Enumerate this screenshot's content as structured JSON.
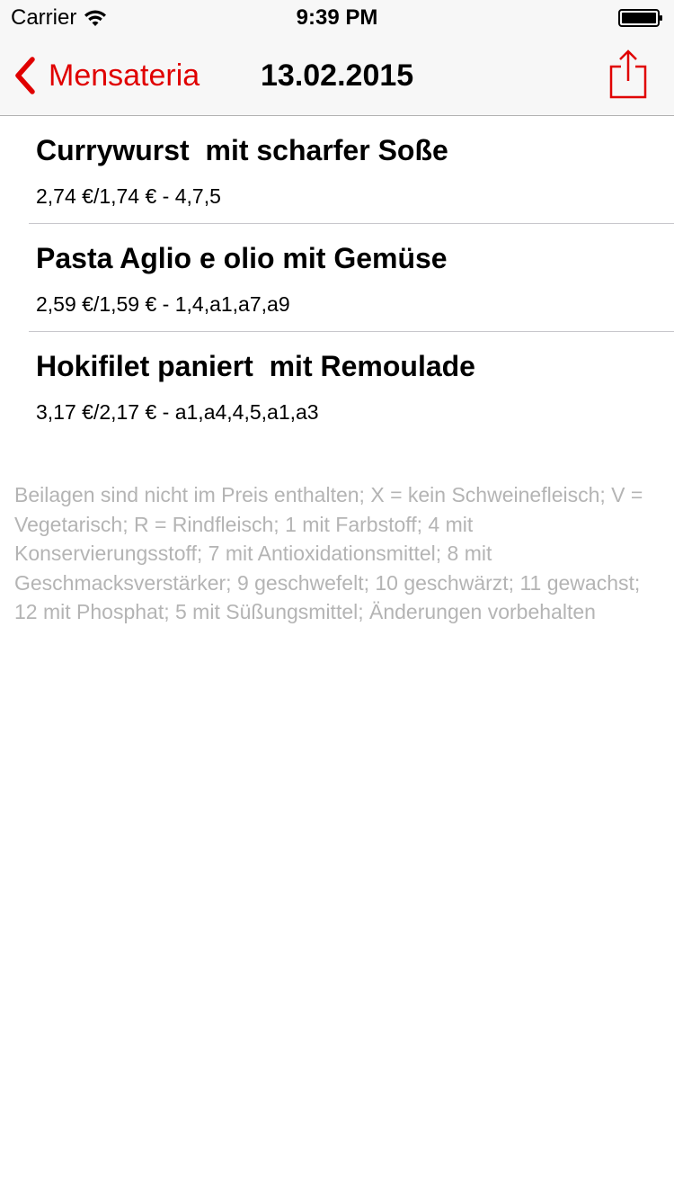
{
  "status_bar": {
    "carrier": "Carrier",
    "time": "9:39 PM",
    "wifi_icon": "wifi-icon",
    "battery_icon": "battery-icon"
  },
  "nav_bar": {
    "back_label": "Mensateria",
    "title": "13.02.2015",
    "back_icon": "chevron-left-icon",
    "share_icon": "share-icon"
  },
  "accent_color": "#e00000",
  "menu_items": [
    {
      "name": "Currywurst  mit scharfer Soße",
      "price": "2,74 €/1,74 € - 4,7,5"
    },
    {
      "name": "Pasta Aglio e olio mit Gemüse",
      "price": "2,59 €/1,59 € - 1,4,a1,a7,a9"
    },
    {
      "name": "Hokifilet paniert  mit Remoulade",
      "price": "3,17 €/2,17 € - a1,a4,4,5,a1,a3"
    }
  ],
  "legend_note": "Beilagen sind nicht im Preis enthalten; X = kein Schweinefleisch; V = Vegetarisch; R = Rindfleisch; 1 mit Farbstoff; 4 mit Konservierungsstoff; 7 mit Antioxidationsmittel; 8 mit Geschmacksverstärker; 9 geschwefelt; 10 geschwärzt; 11 gewachst; 12 mit Phosphat; 5 mit Süßungsmittel; Änderungen vorbehalten"
}
